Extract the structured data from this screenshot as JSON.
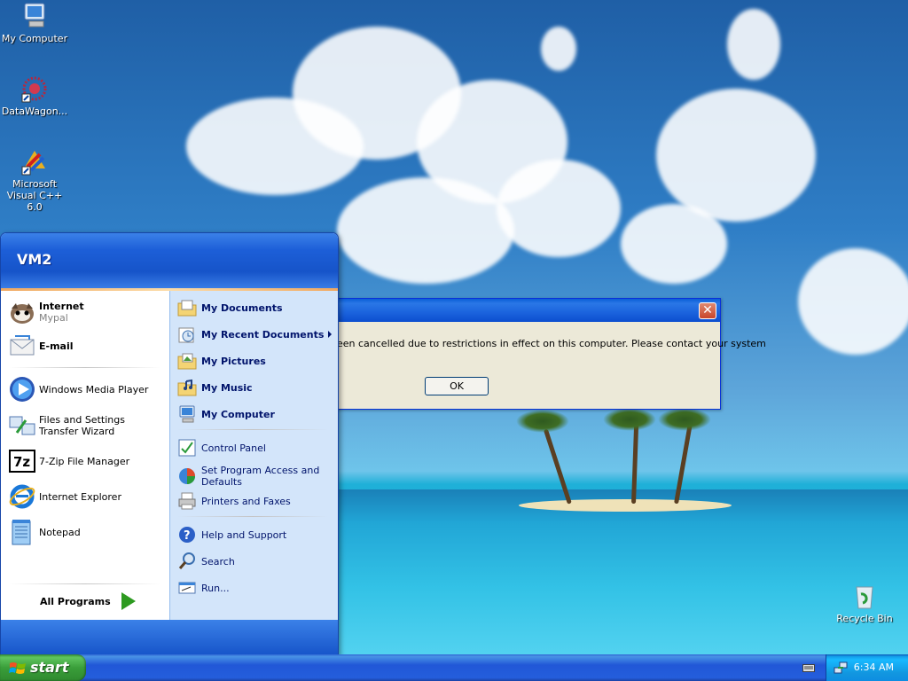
{
  "desktop": {
    "icons": [
      {
        "label": "My Computer",
        "icon": "my-computer-icon"
      },
      {
        "label": "DataWagon...",
        "icon": "datawagon-icon"
      },
      {
        "label": "Microsoft Visual C++ 6.0",
        "icon": "visual-cpp-icon"
      },
      {
        "label": "Recycle Bin",
        "icon": "recycle-bin-icon"
      }
    ]
  },
  "start_menu": {
    "user": "VM2",
    "pinned": [
      {
        "label": "Internet",
        "sub": "Mypal",
        "icon": "mypal-browser-icon"
      },
      {
        "label": "E-mail",
        "icon": "email-icon"
      }
    ],
    "recent": [
      {
        "label": "Windows Media Player",
        "icon": "media-player-icon"
      },
      {
        "label": "Files and Settings Transfer Wizard",
        "icon": "transfer-wizard-icon"
      },
      {
        "label": "7-Zip File Manager",
        "icon": "7zip-icon"
      },
      {
        "label": "Internet Explorer",
        "icon": "internet-explorer-icon"
      },
      {
        "label": "Notepad",
        "icon": "notepad-icon"
      }
    ],
    "all_programs": "All Programs",
    "right": [
      {
        "label": "My Documents",
        "icon": "documents-folder-icon"
      },
      {
        "label": "My Recent Documents",
        "icon": "recent-documents-icon"
      },
      {
        "label": "My Pictures",
        "icon": "pictures-folder-icon"
      },
      {
        "label": "My Music",
        "icon": "music-folder-icon"
      },
      {
        "label": "My Computer",
        "icon": "computer-icon"
      },
      {
        "label": "Control Panel",
        "icon": "control-panel-icon"
      },
      {
        "label": "Set Program Access and Defaults",
        "icon": "program-access-icon"
      },
      {
        "label": "Printers and Faxes",
        "icon": "printer-icon"
      },
      {
        "label": "Help and Support",
        "icon": "help-icon"
      },
      {
        "label": "Search",
        "icon": "search-icon"
      },
      {
        "label": "Run...",
        "icon": "run-icon"
      }
    ]
  },
  "dialog": {
    "message": "een cancelled due to restrictions in effect on this computer. Please contact your system",
    "ok_label": "OK",
    "close_label": "✕"
  },
  "taskbar": {
    "start_label": "start",
    "clock": "6:34 AM"
  },
  "colors": {
    "xp_blue": "#245edc",
    "start_green": "#3a9e3a",
    "menu_right_bg": "#d3e5fa",
    "dialog_bg": "#ece9d8"
  }
}
